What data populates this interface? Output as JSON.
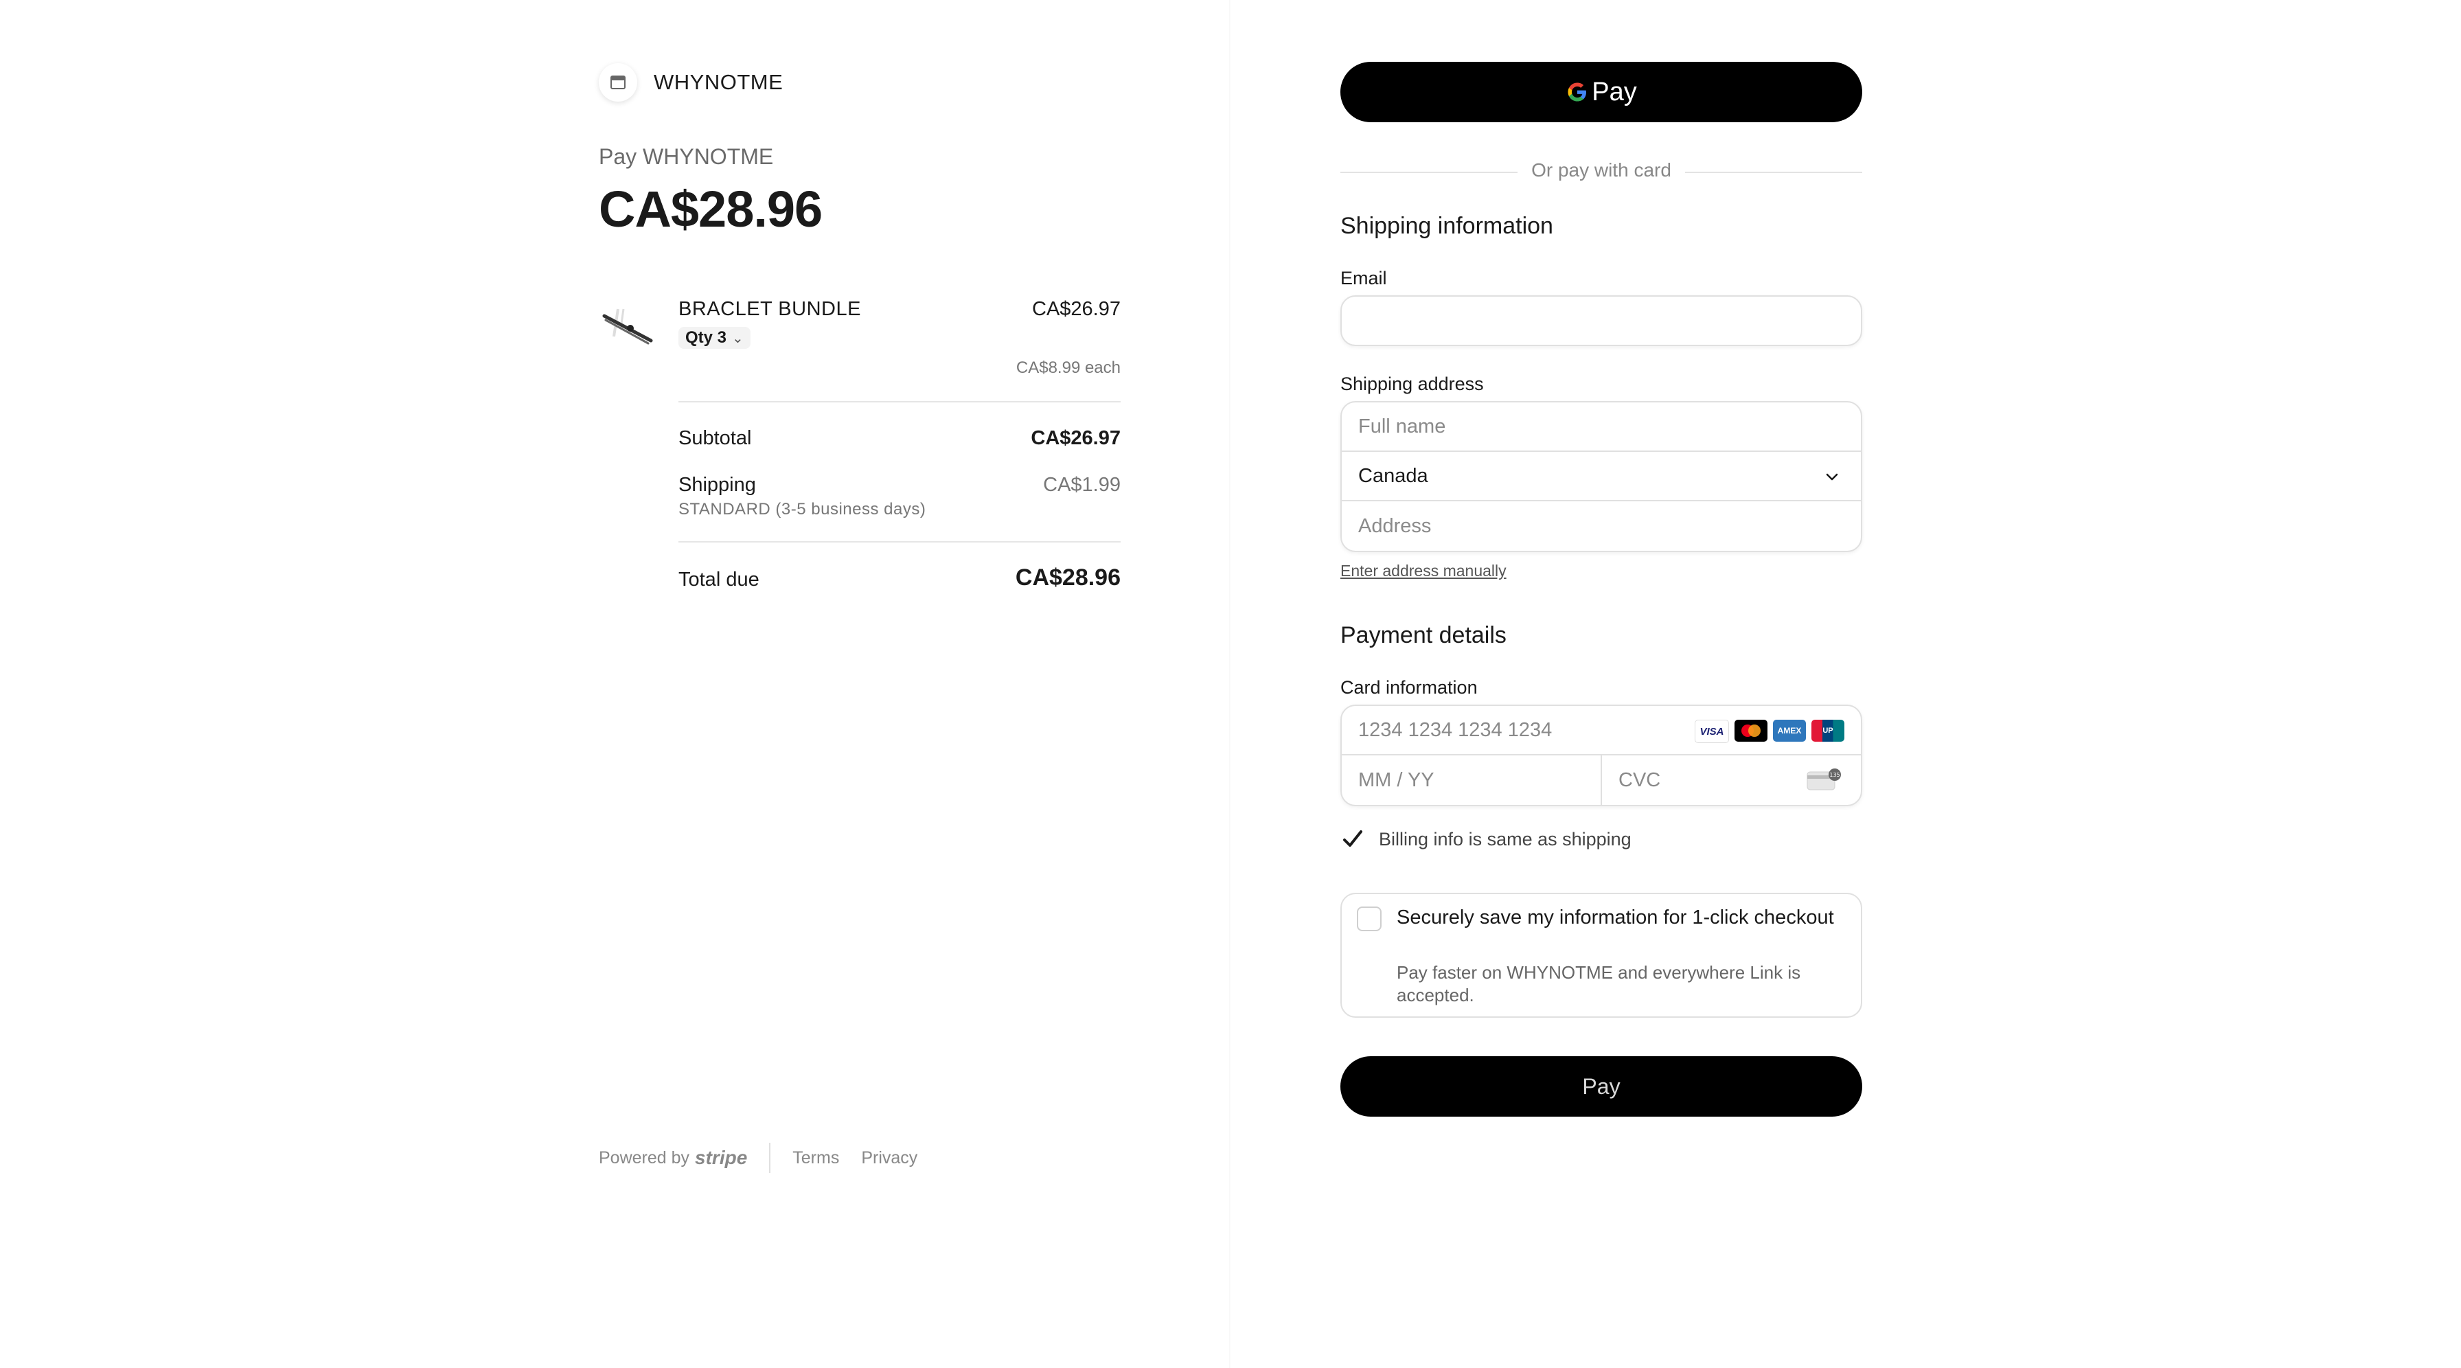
{
  "merchant": {
    "name": "WHYNOTME"
  },
  "summary": {
    "pay_label": "Pay WHYNOTME",
    "amount": "CA$28.96"
  },
  "item": {
    "name": "BRACLET BUNDLE",
    "price": "CA$26.97",
    "qty": "Qty 3",
    "each": "CA$8.99 each"
  },
  "totals": {
    "subtotal_label": "Subtotal",
    "subtotal_value": "CA$26.97",
    "shipping_label": "Shipping",
    "shipping_value": "CA$1.99",
    "shipping_sub": "STANDARD (3-5 business days)",
    "total_label": "Total due",
    "total_value": "CA$28.96"
  },
  "footer": {
    "powered_by": "Powered by",
    "brand": "stripe",
    "terms": "Terms",
    "privacy": "Privacy"
  },
  "checkout": {
    "gpay_label": "Pay",
    "or_text": "Or pay with card",
    "shipping_title": "Shipping information",
    "email_label": "Email",
    "email_value": "",
    "address_label": "Shipping address",
    "full_name_placeholder": "Full name",
    "country_value": "Canada",
    "address_placeholder": "Address",
    "manual_link": "Enter address manually",
    "payment_title": "Payment details",
    "card_label": "Card information",
    "card_placeholder": "1234 1234 1234 1234",
    "expiry_placeholder": "MM / YY",
    "cvc_placeholder": "CVC",
    "card_brands": [
      "VISA",
      "mastercard",
      "amex",
      "unionpay"
    ],
    "billing_same_label": "Billing info is same as shipping",
    "billing_same_checked": true,
    "link_title": "Securely save my information for 1-click checkout",
    "link_sub": "Pay faster on WHYNOTME and everywhere Link is accepted.",
    "link_checked": false,
    "pay_button": "Pay"
  }
}
